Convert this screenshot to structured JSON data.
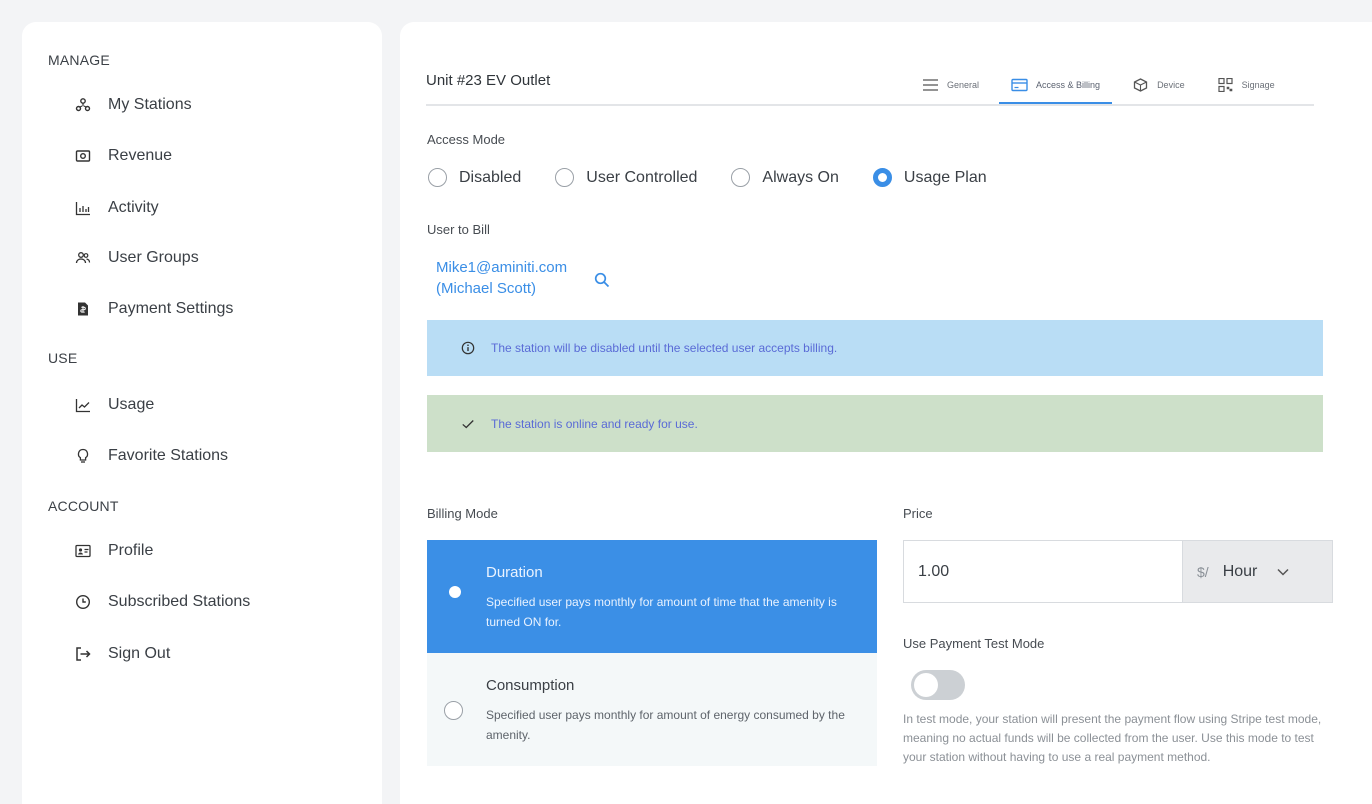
{
  "sidebar": {
    "sections": {
      "manage": "MANAGE",
      "use": "USE",
      "account": "ACCOUNT"
    },
    "items": [
      {
        "label": "My Stations",
        "icon": "stations-icon"
      },
      {
        "label": "Revenue",
        "icon": "revenue-icon"
      },
      {
        "label": "Activity",
        "icon": "activity-icon"
      },
      {
        "label": "User Groups",
        "icon": "user-groups-icon"
      },
      {
        "label": "Payment Settings",
        "icon": "payment-settings-icon"
      },
      {
        "label": "Usage",
        "icon": "usage-icon"
      },
      {
        "label": "Favorite Stations",
        "icon": "favorite-icon"
      },
      {
        "label": "Profile",
        "icon": "profile-icon"
      },
      {
        "label": "Subscribed Stations",
        "icon": "clock-icon"
      },
      {
        "label": "Sign Out",
        "icon": "sign-out-icon"
      }
    ]
  },
  "header": {
    "title": "Unit #23 EV Outlet",
    "tabs": [
      {
        "label": "General",
        "icon": "list-icon"
      },
      {
        "label": "Access & Billing",
        "icon": "billing-card-icon",
        "active": true
      },
      {
        "label": "Device",
        "icon": "device-icon"
      },
      {
        "label": "Signage",
        "icon": "qr-code-icon"
      }
    ]
  },
  "access": {
    "label": "Access Mode",
    "options": [
      "Disabled",
      "User Controlled",
      "Always On",
      "Usage Plan"
    ],
    "selected": "Usage Plan"
  },
  "user_to_bill": {
    "label": "User to Bill",
    "email": "Mike1@aminiti.com",
    "name": "(Michael Scott)"
  },
  "alerts": {
    "info": "The station will be disabled until the selected user accepts billing.",
    "success": "The station is online and ready for use."
  },
  "billing": {
    "label": "Billing Mode",
    "options": [
      {
        "title": "Duration",
        "desc": "Specified user pays monthly for amount of time that the amenity is turned ON for.",
        "selected": true
      },
      {
        "title": "Consumption",
        "desc": "Specified user pays monthly for amount of energy consumed by the amenity.",
        "selected": false
      }
    ]
  },
  "price": {
    "label": "Price",
    "value": "1.00",
    "currency": "$/",
    "unit": "Hour"
  },
  "test_mode": {
    "label": "Use Payment Test Mode",
    "enabled": false,
    "help": "In test mode, your station will present the payment flow using Stripe test mode, meaning no actual funds will be collected from the user. Use this mode to test your station without having to use a real payment method."
  },
  "colors": {
    "accent": "#3a8ee6",
    "info_bg": "#b9ddf5",
    "success_bg": "#cde0c9"
  }
}
